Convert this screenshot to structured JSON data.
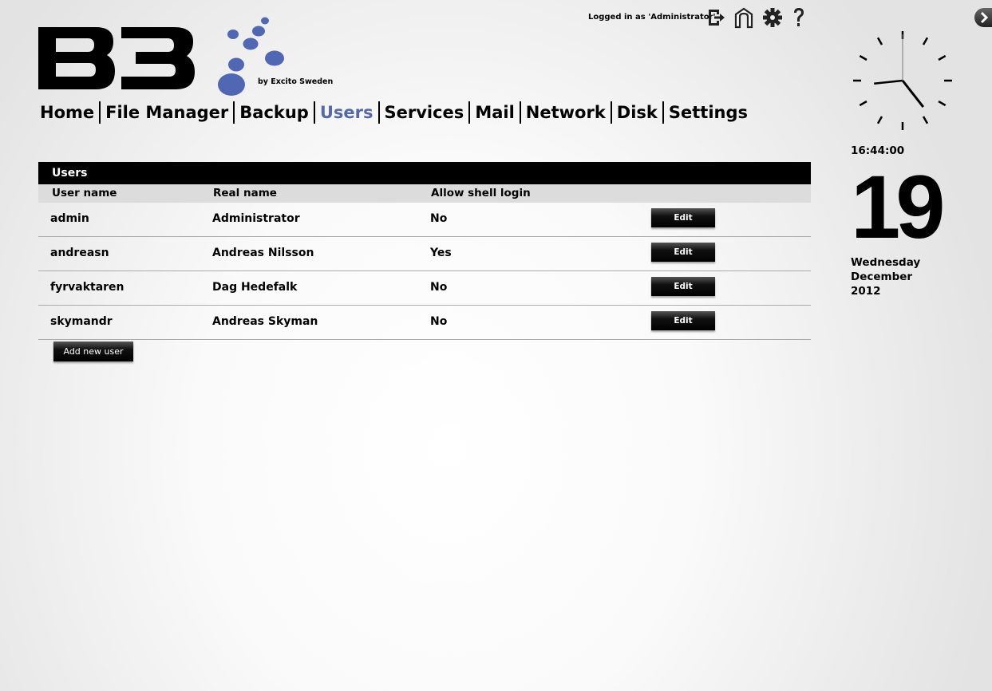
{
  "logo": {
    "wordmark": "B3",
    "byline": "by Excito Sweden"
  },
  "topbar": {
    "login_text": "Logged in as 'Administrator'",
    "icons": [
      "logout-icon",
      "home-icon",
      "gear-icon",
      "help-icon"
    ]
  },
  "nav": {
    "items": [
      {
        "label": "Home"
      },
      {
        "label": "File Manager"
      },
      {
        "label": "Backup"
      },
      {
        "label": "Users",
        "active": true
      },
      {
        "label": "Services"
      },
      {
        "label": "Mail"
      },
      {
        "label": "Network"
      },
      {
        "label": "Disk"
      },
      {
        "label": "Settings"
      }
    ],
    "active_color": "#5468aa"
  },
  "users": {
    "title": "Users",
    "columns": [
      "User name",
      "Real name",
      "Allow shell login"
    ],
    "rows": [
      {
        "username": "admin",
        "realname": "Administrator",
        "shell": "No",
        "action": "Edit"
      },
      {
        "username": "andreasn",
        "realname": "Andreas Nilsson",
        "shell": "Yes",
        "action": "Edit"
      },
      {
        "username": "fyrvaktaren",
        "realname": "Dag Hedefalk",
        "shell": "No",
        "action": "Edit"
      },
      {
        "username": "skymandr",
        "realname": "Andreas Skyman",
        "shell": "No",
        "action": "Edit"
      }
    ],
    "add_button": "Add new user"
  },
  "sidebar": {
    "time": "16:44:00",
    "day": "19",
    "weekday": "Wednesday",
    "month": "December",
    "year": "2012",
    "clock": {
      "hours": 16,
      "minutes": 44,
      "seconds": 0
    }
  }
}
